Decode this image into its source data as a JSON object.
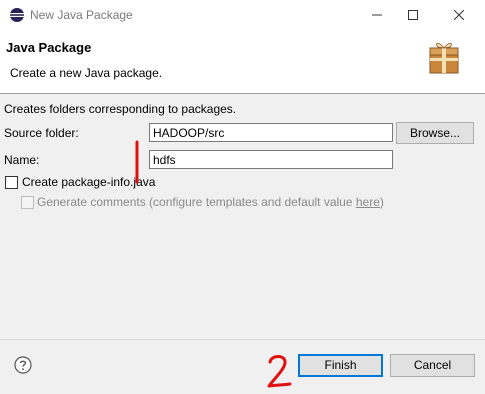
{
  "window": {
    "title": "New Java Package",
    "app_icon": "eclipse-icon",
    "controls": [
      "minimize-icon",
      "maximize-icon",
      "close-icon"
    ]
  },
  "header": {
    "title": "Java Package",
    "description": "Create a new Java package.",
    "icon": "package-icon"
  },
  "form": {
    "info": "Creates folders corresponding to packages.",
    "source_folder_label": "Source folder:",
    "source_folder_value": "HADOOP/src",
    "browse_label": "Browse...",
    "name_label": "Name:",
    "name_value": "hdfs",
    "create_package_info_label": "Create package-info.java",
    "create_package_info_checked": false,
    "generate_comments_prefix": "Generate comments (configure templates and default value ",
    "generate_comments_link": "here",
    "generate_comments_suffix": ")",
    "generate_comments_enabled": false
  },
  "footer": {
    "help_icon": "help-icon",
    "finish_label": "Finish",
    "cancel_label": "Cancel"
  },
  "annotations": {
    "mark_1": "|",
    "mark_2": "2",
    "color": "#e01010"
  }
}
